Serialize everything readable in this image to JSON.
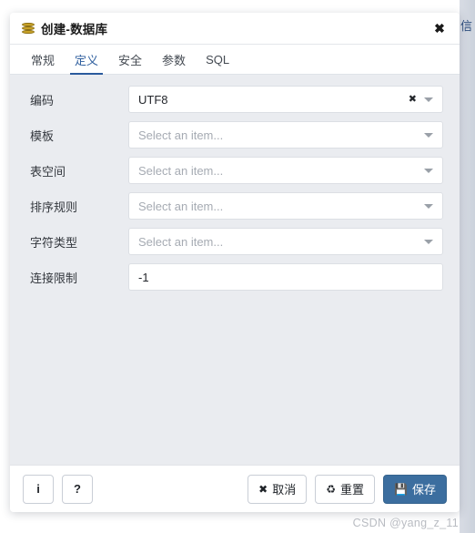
{
  "backdrop": {
    "partial_text": "信"
  },
  "dialog": {
    "title": "创建-数据库",
    "title_icon": "database-icon",
    "close_icon": "✖",
    "tabs": [
      {
        "label": "常规",
        "active": false
      },
      {
        "label": "定义",
        "active": true
      },
      {
        "label": "安全",
        "active": false
      },
      {
        "label": "参数",
        "active": false
      },
      {
        "label": "SQL",
        "active": false
      }
    ],
    "form": {
      "rows": [
        {
          "label": "编码",
          "value": "UTF8",
          "placeholder": "Select an item...",
          "type": "select",
          "has_clear": true,
          "has_caret": true
        },
        {
          "label": "模板",
          "value": "",
          "placeholder": "Select an item...",
          "type": "select",
          "has_clear": false,
          "has_caret": true
        },
        {
          "label": "表空间",
          "value": "",
          "placeholder": "Select an item...",
          "type": "select",
          "has_clear": false,
          "has_caret": true
        },
        {
          "label": "排序规则",
          "value": "",
          "placeholder": "Select an item...",
          "type": "select",
          "has_clear": false,
          "has_caret": true
        },
        {
          "label": "字符类型",
          "value": "",
          "placeholder": "Select an item...",
          "type": "select",
          "has_clear": false,
          "has_caret": true
        },
        {
          "label": "连接限制",
          "value": "-1",
          "placeholder": "",
          "type": "text",
          "has_clear": false,
          "has_caret": false
        }
      ]
    },
    "footer": {
      "info_label": "i",
      "help_label": "?",
      "cancel_label": "取消",
      "cancel_glyph": "✖",
      "reset_label": "重置",
      "reset_glyph": "♻",
      "save_label": "保存",
      "save_glyph": "💾"
    }
  },
  "watermark": "CSDN @yang_z_11",
  "colors": {
    "accent": "#3c6e9f",
    "tab_active": "#2a5a9c",
    "form_background": "#eaecf0",
    "db_icon": "#c9a227"
  }
}
